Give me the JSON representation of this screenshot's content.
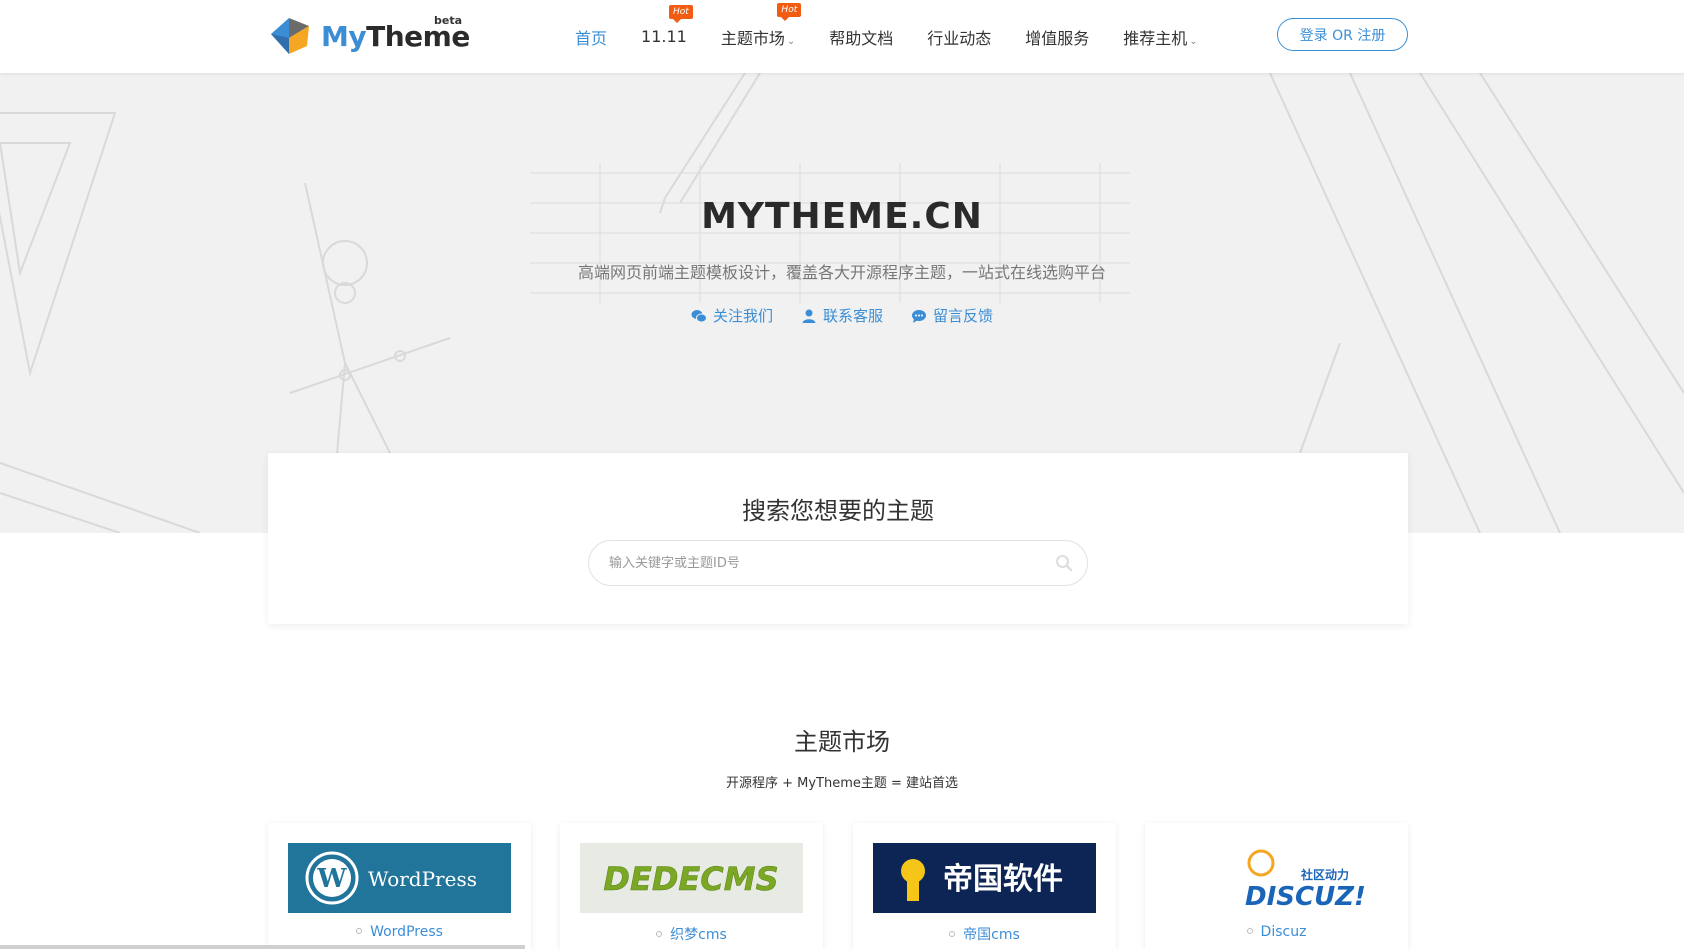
{
  "logo": {
    "my": "My",
    "theme": "Theme",
    "beta": "beta"
  },
  "nav": {
    "items": [
      {
        "label": "首页",
        "active": true,
        "hot": "",
        "caret": false
      },
      {
        "label": "11.11",
        "active": false,
        "hot": "Hot",
        "caret": false
      },
      {
        "label": "主题市场",
        "active": false,
        "hot": "Hot",
        "caret": true
      },
      {
        "label": "帮助文档",
        "active": false,
        "hot": "",
        "caret": false
      },
      {
        "label": "行业动态",
        "active": false,
        "hot": "",
        "caret": false
      },
      {
        "label": "增值服务",
        "active": false,
        "hot": "",
        "caret": false
      },
      {
        "label": "推荐主机",
        "active": false,
        "hot": "",
        "caret": true
      }
    ],
    "login_label": "登录 OR 注册"
  },
  "hero": {
    "title": "MYTHEME.CN",
    "subtitle": "高端网页前端主题模板设计，覆盖各大开源程序主题，一站式在线选购平台",
    "links": [
      {
        "label": "关注我们",
        "icon": "wechat-icon"
      },
      {
        "label": "联系客服",
        "icon": "user-icon"
      },
      {
        "label": "留言反馈",
        "icon": "chat-icon"
      }
    ]
  },
  "search": {
    "title": "搜索您想要的主题",
    "placeholder": "输入关键字或主题ID号",
    "value": ""
  },
  "market": {
    "title": "主题市场",
    "subtitle": "开源程序 + MyTheme主题 = 建站首选",
    "cards": [
      {
        "label": "WordPress",
        "logo_text": "WordPress"
      },
      {
        "label": "织梦cms",
        "logo_text": "DEDECMS"
      },
      {
        "label": "帝国cms",
        "logo_text": "帝国软件"
      },
      {
        "label": "Discuz",
        "logo_text": "DISCUZ!",
        "logo_sub": "社区动力"
      }
    ]
  },
  "colors": {
    "accent": "#3b8ed6",
    "hot_badge": "#f25b12",
    "hero_bg": "#f1f1f1"
  }
}
